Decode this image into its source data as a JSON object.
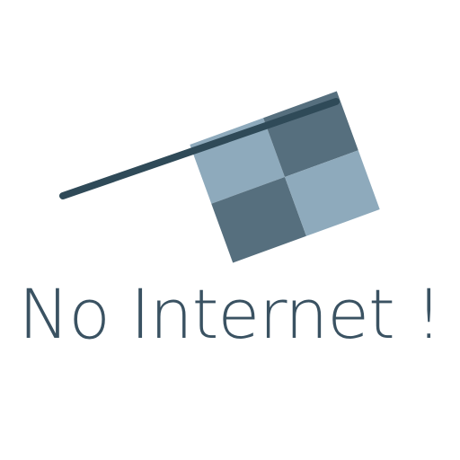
{
  "message": {
    "text": "No Internet !",
    "color": "#3a5262"
  },
  "illustration": {
    "icon": "checkered-flag-icon",
    "pole_color": "#2f4a58",
    "flag_dark_color": "#566f7e",
    "flag_light_color": "#8eaabc"
  }
}
